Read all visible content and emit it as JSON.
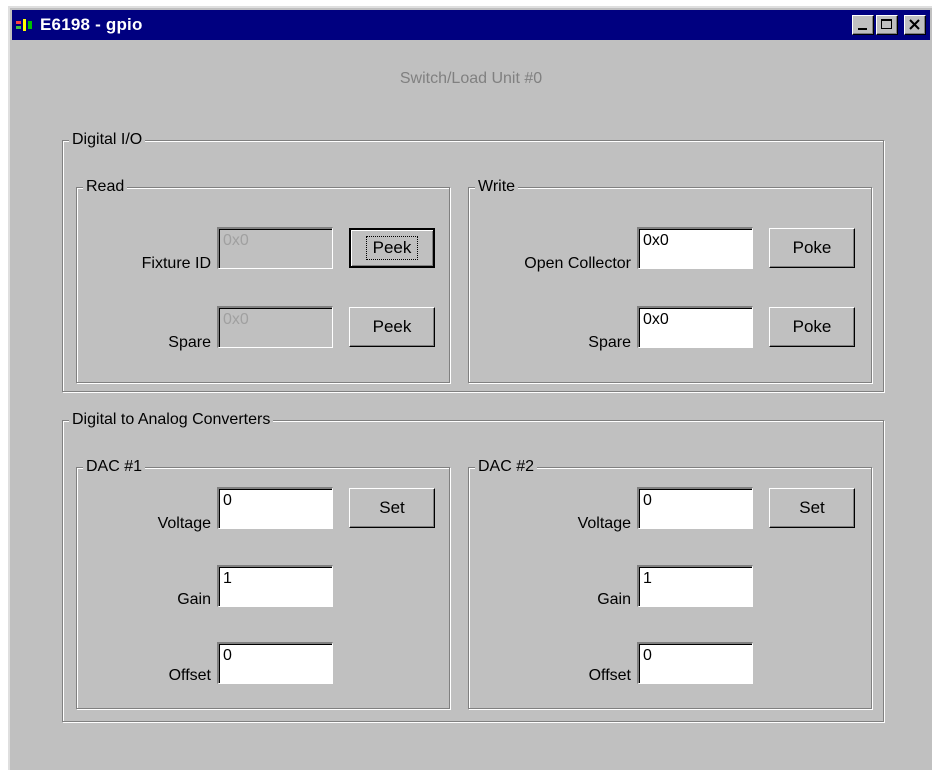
{
  "window": {
    "title": "E6198 - gpio"
  },
  "heading": "Switch/Load Unit #0",
  "digital_io": {
    "title": "Digital I/O",
    "read": {
      "title": "Read",
      "fixture_label": "Fixture ID",
      "fixture_value": "0x0",
      "fixture_button": "Peek",
      "spare_label": "Spare",
      "spare_value": "0x0",
      "spare_button": "Peek"
    },
    "write": {
      "title": "Write",
      "oc_label": "Open Collector",
      "oc_value": "0x0",
      "oc_button": "Poke",
      "spare_label": "Spare",
      "spare_value": "0x0",
      "spare_button": "Poke"
    }
  },
  "dac": {
    "title": "Digital to Analog Converters",
    "dac1": {
      "title": "DAC #1",
      "voltage_label": "Voltage",
      "voltage_value": "0",
      "set_button": "Set",
      "gain_label": "Gain",
      "gain_value": "1",
      "offset_label": "Offset",
      "offset_value": "0"
    },
    "dac2": {
      "title": "DAC #2",
      "voltage_label": "Voltage",
      "voltage_value": "0",
      "set_button": "Set",
      "gain_label": "Gain",
      "gain_value": "1",
      "offset_label": "Offset",
      "offset_value": "0"
    }
  }
}
